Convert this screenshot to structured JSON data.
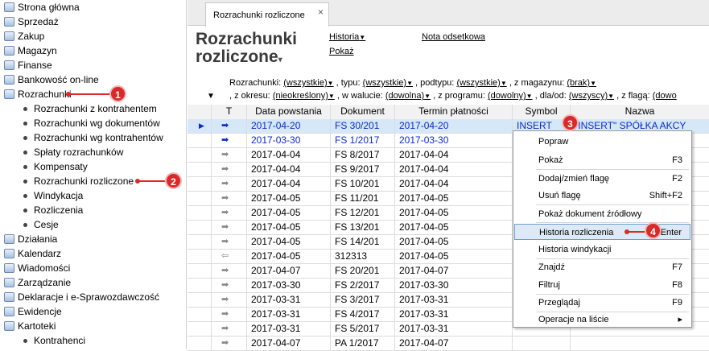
{
  "sidebar": {
    "items": [
      {
        "label": "Strona główna"
      },
      {
        "label": "Sprzedaż"
      },
      {
        "label": "Zakup"
      },
      {
        "label": "Magazyn"
      },
      {
        "label": "Finanse"
      },
      {
        "label": "Bankowość on-line"
      },
      {
        "label": "Rozrachunki"
      }
    ],
    "sub_items": [
      {
        "label": "Rozrachunki z kontrahentem"
      },
      {
        "label": "Rozrachunki wg dokumentów"
      },
      {
        "label": "Rozrachunki wg kontrahentów"
      },
      {
        "label": "Spłaty rozrachunków"
      },
      {
        "label": "Kompensaty"
      },
      {
        "label": "Rozrachunki rozliczone"
      },
      {
        "label": "Windykacja"
      },
      {
        "label": "Rozliczenia"
      },
      {
        "label": "Cesje"
      }
    ],
    "items2": [
      {
        "label": "Działania"
      },
      {
        "label": "Kalendarz"
      },
      {
        "label": "Wiadomości"
      },
      {
        "label": "Zarządzanie"
      },
      {
        "label": "Deklaracje i e-Sprawozdawczość"
      },
      {
        "label": "Ewidencje"
      },
      {
        "label": "Kartoteki"
      }
    ],
    "sub_items2": [
      {
        "label": "Kontrahenci"
      }
    ]
  },
  "tab": {
    "label": "Rozrachunki rozliczone",
    "close": "×"
  },
  "page": {
    "title_line1": "Rozrachunki",
    "title_line2": "rozliczone",
    "caret": "▾"
  },
  "toplinks": {
    "historia": "Historia",
    "pokaz": "Pokaż",
    "nota": "Nota odsetkowa"
  },
  "filters": {
    "rozrachunki_label": "Rozrachunki:",
    "rozrachunki_val": "(wszystkie)",
    "typu_label": ", typu:",
    "typu_val": "(wszystkie)",
    "podtypu_label": ", podtypu:",
    "podtypu_val": "(wszystkie)",
    "magazynu_label": ", z magazynu:",
    "magazynu_val": "(brak)",
    "okresu_label": ", z okresu:",
    "okresu_val": "(nieokreślony)",
    "walucie_label": ", w walucie:",
    "walucie_val": "(dowolna)",
    "programu_label": ", z programu:",
    "programu_val": "(dowolny)",
    "dla_label": ", dla/od:",
    "dla_val": "(wszyscy)",
    "flaga_label": ", z flagą:",
    "flaga_val": "(dowo"
  },
  "table": {
    "columns": [
      "T",
      "Data powstania",
      "Dokument",
      "Termin płatności",
      "Symbol",
      "Nazwa"
    ],
    "rows": [
      {
        "arrow": "➡",
        "data": "2017-04-20",
        "dok": "FS 30/201",
        "termin": "2017-04-20",
        "symbol": "INSERT",
        "nazwa": "\"INSERT\" SPÓŁKA AKCY"
      },
      {
        "arrow": "➡",
        "data": "2017-03-30",
        "dok": "FS 1/2017",
        "termin": "2017-03-30",
        "symbol": "",
        "nazwa": ""
      },
      {
        "arrow": "➡",
        "data": "2017-04-04",
        "dok": "FS 8/2017",
        "termin": "2017-04-04",
        "symbol": "",
        "nazwa": ""
      },
      {
        "arrow": "➡",
        "data": "2017-04-04",
        "dok": "FS 9/2017",
        "termin": "2017-04-04",
        "symbol": "",
        "nazwa": ""
      },
      {
        "arrow": "➡",
        "data": "2017-04-04",
        "dok": "FS 10/201",
        "termin": "2017-04-04",
        "symbol": "",
        "nazwa": ""
      },
      {
        "arrow": "➡",
        "data": "2017-04-05",
        "dok": "FS 11/201",
        "termin": "2017-04-05",
        "symbol": "",
        "nazwa": ""
      },
      {
        "arrow": "➡",
        "data": "2017-04-05",
        "dok": "FS 12/201",
        "termin": "2017-04-05",
        "symbol": "",
        "nazwa": ""
      },
      {
        "arrow": "➡",
        "data": "2017-04-05",
        "dok": "FS 13/201",
        "termin": "2017-04-05",
        "symbol": "",
        "nazwa": ""
      },
      {
        "arrow": "➡",
        "data": "2017-04-05",
        "dok": "FS 14/201",
        "termin": "2017-04-05",
        "symbol": "",
        "nazwa": ""
      },
      {
        "arrow": "⇦",
        "data": "2017-04-05",
        "dok": "312313",
        "termin": "2017-04-05",
        "symbol": "",
        "nazwa": ""
      },
      {
        "arrow": "➡",
        "data": "2017-04-07",
        "dok": "FS 20/201",
        "termin": "2017-04-07",
        "symbol": "",
        "nazwa": ""
      },
      {
        "arrow": "➡",
        "data": "2017-03-30",
        "dok": "FS 2/2017",
        "termin": "2017-03-30",
        "symbol": "",
        "nazwa": ""
      },
      {
        "arrow": "➡",
        "data": "2017-03-31",
        "dok": "FS 3/2017",
        "termin": "2017-03-31",
        "symbol": "",
        "nazwa": ""
      },
      {
        "arrow": "➡",
        "data": "2017-03-31",
        "dok": "FS 4/2017",
        "termin": "2017-03-31",
        "symbol": "",
        "nazwa": ""
      },
      {
        "arrow": "➡",
        "data": "2017-03-31",
        "dok": "FS 5/2017",
        "termin": "2017-03-31",
        "symbol": "",
        "nazwa": ""
      },
      {
        "arrow": "➡",
        "data": "2017-04-07",
        "dok": "PA 1/2017",
        "termin": "2017-04-07",
        "symbol": "",
        "nazwa": ""
      }
    ]
  },
  "context_menu": {
    "items": [
      {
        "label": "Popraw",
        "shortcut": ""
      },
      {
        "label": "Pokaż",
        "shortcut": "F3"
      },
      {
        "label": "Dodaj/zmień flagę",
        "shortcut": "F2"
      },
      {
        "label": "Usuń flagę",
        "shortcut": "Shift+F2"
      },
      {
        "label": "Pokaż dokument źródłowy",
        "shortcut": ""
      },
      {
        "label": "Historia rozliczenia",
        "shortcut": "Enter"
      },
      {
        "label": "Historia windykacji",
        "shortcut": ""
      },
      {
        "label": "Znajdź",
        "shortcut": "F7"
      },
      {
        "label": "Filtruj",
        "shortcut": "F8"
      },
      {
        "label": "Przeglądaj",
        "shortcut": "F9"
      },
      {
        "label": "Operacje na liście",
        "shortcut": "▸"
      }
    ]
  },
  "badges": [
    "1",
    "2",
    "3",
    "4"
  ],
  "colors": {
    "accent": "#d92a2a",
    "link_blue": "#0a2ad0",
    "selection": "#d6e8f8"
  }
}
